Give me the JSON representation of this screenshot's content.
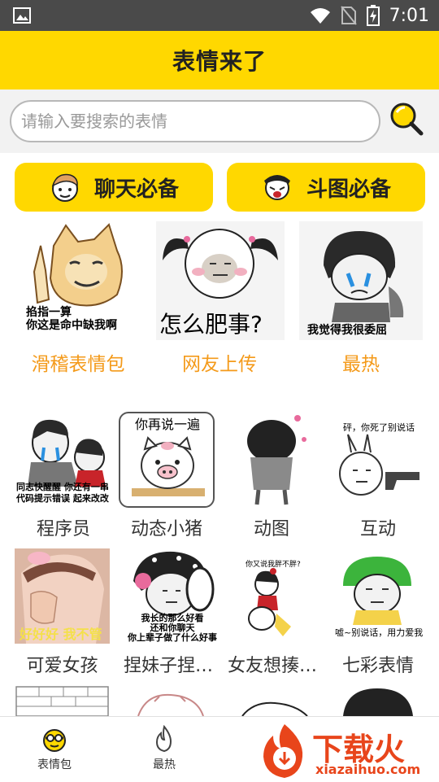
{
  "status_bar": {
    "time": "7:01"
  },
  "header": {
    "title": "表情来了"
  },
  "search": {
    "placeholder": "请输入要搜索的表情"
  },
  "categories": [
    {
      "label": "聊天必备"
    },
    {
      "label": "斗图必备"
    }
  ],
  "featured": [
    {
      "label": "滑稽表情包",
      "caption": "掐指一算\n你这是命中缺我啊"
    },
    {
      "label": "网友上传",
      "caption": "怎么肥事?"
    },
    {
      "label": "最热",
      "caption": "我觉得我很委屈"
    }
  ],
  "items_row1": [
    {
      "label": "程序员",
      "caption": "同志快醒醒 你还有一串\n代码提示错误 起来改改"
    },
    {
      "label": "动态小猪",
      "caption": "你再说一遍"
    },
    {
      "label": "动图",
      "caption": ""
    },
    {
      "label": "互动",
      "caption": "砰，你死了别说话"
    }
  ],
  "items_row2": [
    {
      "label": "可爱女孩",
      "caption": "好好好 我不管"
    },
    {
      "label": "捏妹子捏…",
      "caption": "我长的那么好看\n还和你聊天\n你上辈子做了什么好事"
    },
    {
      "label": "女友想揍…",
      "caption": "你又说我胖不胖?"
    },
    {
      "label": "七彩表情",
      "caption": "嘘~别说话，用力爱我"
    }
  ],
  "bottom_nav": [
    {
      "label": "表情包",
      "icon": "emoji-face-icon"
    },
    {
      "label": "最热",
      "icon": "flame-icon"
    }
  ],
  "watermark": {
    "brand": "下载火",
    "url": "xiazaihuo.com"
  },
  "colors": {
    "accent": "#ffd800",
    "featured_label": "#f49a1a",
    "status_bar": "#4a4a4a",
    "watermark": "#e8451b"
  }
}
